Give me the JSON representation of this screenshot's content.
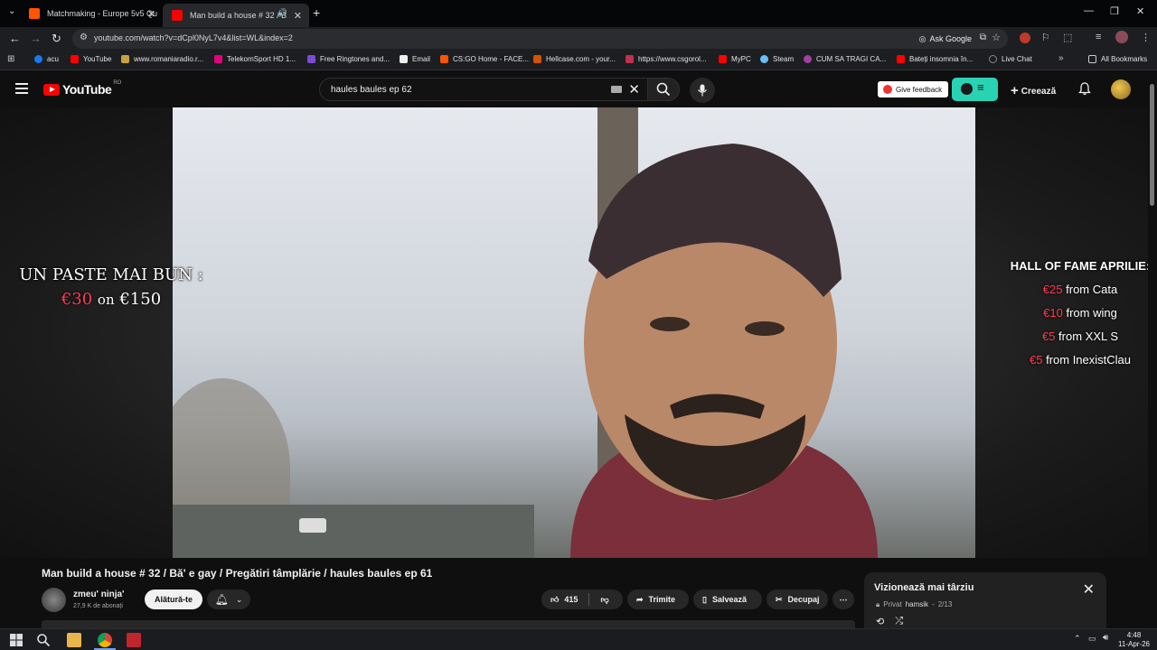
{
  "browser": {
    "tabs": [
      {
        "label": "Matchmaking - Europe 5v5 Qu"
      },
      {
        "label": "Man build a house # 32 / B"
      }
    ],
    "url": "youtube.com/watch?v=dCpl0NyL7v4&list=WL&index=2",
    "ask_google": "Ask Google",
    "bookmarks": [
      {
        "label": "acu",
        "color": "#1877f2"
      },
      {
        "label": "YouTube",
        "color": "#ff0000"
      },
      {
        "label": "www.romaniaradio.r...",
        "color": "#c8a040"
      },
      {
        "label": "TelekomSport HD 1...",
        "color": "#e5007d"
      },
      {
        "label": "Free Ringtones and...",
        "color": "#7b4bd6"
      },
      {
        "label": "Email",
        "color": "#eeeeee"
      },
      {
        "label": "CS:GO Home - FACE...",
        "color": "#ff5500"
      },
      {
        "label": "Hellcase.com - your...",
        "color": "#d35400"
      },
      {
        "label": "https://www.csgorol...",
        "color": "#c03050"
      },
      {
        "label": "MyPC",
        "color": "#ff0000"
      },
      {
        "label": "Steam",
        "color": "#66c0f4"
      },
      {
        "label": "CUM SA TRAGI CA...",
        "color": "#a040a0"
      },
      {
        "label": "Bateți insomnia în...",
        "color": "#ff0000"
      },
      {
        "label": "Live Chat",
        "color": "#888888"
      }
    ],
    "all_bookmarks": "All Bookmarks"
  },
  "youtube": {
    "logo_word": "YouTube",
    "logo_region": "RO",
    "search": {
      "value": "haules baules ep 62"
    },
    "feedback_label": "Give feedback",
    "create_label": "Creează",
    "overlay_left": {
      "line1": "UN PASTE MAI BUN :",
      "amount": "€30",
      "on": "on",
      "goal": "€150"
    },
    "overlay_right": {
      "heading": "HALL OF FAME APRILIE:",
      "rows": [
        {
          "amount": "€25",
          "text": "from Cata"
        },
        {
          "amount": "€10",
          "text": "from wing"
        },
        {
          "amount": "€5",
          "text": "from XXL S"
        },
        {
          "amount": "€5",
          "text": "from InexistClau"
        }
      ]
    },
    "video_title": "Man build a house # 32 / Bă' e gay / Pregătiri tâmplărie / haules baules ep 61",
    "channel": {
      "name": "zmeu' ninja'",
      "subs": "27,9 K de abonați"
    },
    "join_label": "Alătură-te",
    "likes": "415",
    "share_label": "Trimite",
    "save_label": "Salvează",
    "clip_label": "Decupaj",
    "watch_later": {
      "title": "Vizionează mai târziu",
      "privacy": "Privat",
      "owner": "hamsik",
      "position": "2/13"
    }
  },
  "taskbar": {
    "time": "4:48",
    "date": "11-Apr-26"
  }
}
